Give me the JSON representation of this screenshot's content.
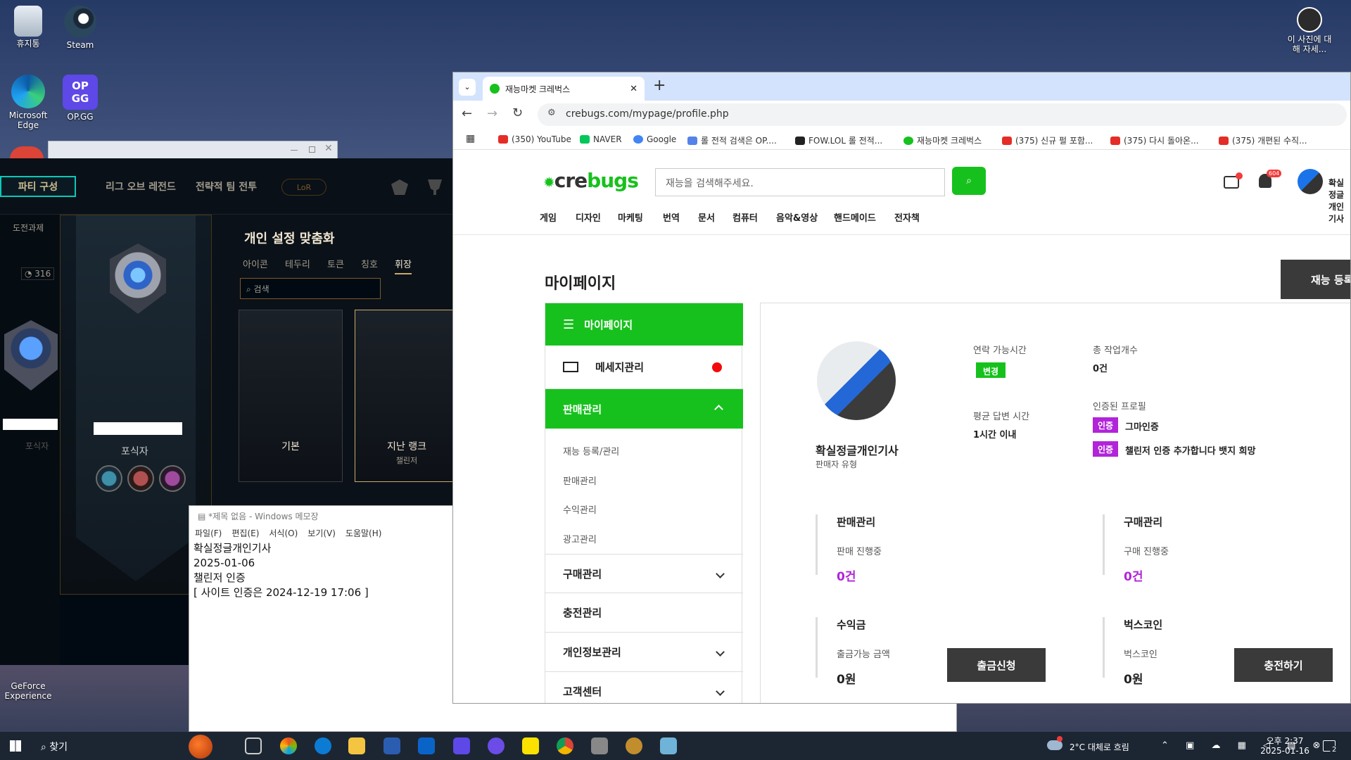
{
  "desktop": {
    "icons": [
      {
        "label": "휴지통"
      },
      {
        "label": "Steam"
      },
      {
        "label": "Microsoft Edge"
      },
      {
        "label": "OP.GG"
      },
      {
        "label": "GeForce Experience"
      }
    ],
    "corner_label": "이 사진에 대해 자세..."
  },
  "lol": {
    "party": "파티 구성",
    "nav": [
      "리그 오브 레전드",
      "전략적 팀 전투"
    ],
    "lor": "LoR",
    "left_label": "도전과제",
    "left_count": "316",
    "left_rank": "포식자",
    "rank_label": "포식자",
    "title": "개인 설정 맞춤화",
    "tabs": [
      "아이콘",
      "테두리",
      "토큰",
      "칭호",
      "휘장"
    ],
    "search_placeholder": "검색",
    "boxes": [
      {
        "title": "기본",
        "sub": ""
      },
      {
        "title": "지난 랭크",
        "sub": "챌린저"
      }
    ]
  },
  "notepad": {
    "title": "*제목 없음 - Windows 메모장",
    "menu": [
      "파일(F)",
      "편집(E)",
      "서식(O)",
      "보기(V)",
      "도움말(H)"
    ],
    "lines": [
      "확실정글개인기사",
      "2025-01-06",
      "챌린저 인증",
      "[ 사이트 인증은 2024-12-19 17:06 ]"
    ]
  },
  "browser": {
    "tab_title": "재능마켓 크레벅스",
    "url": "crebugs.com/mypage/profile.php",
    "bookmarks": [
      {
        "label": "(350) YouTube",
        "color": "#e52d27"
      },
      {
        "label": "NAVER",
        "color": "#03c75a"
      },
      {
        "label": "Google",
        "color": "#4285f4"
      },
      {
        "label": "롤 전적 검색은 OP....",
        "color": "#5383e8"
      },
      {
        "label": "FOW.LOL 롤 전적...",
        "color": "#222222"
      },
      {
        "label": "재능마켓 크레벅스",
        "color": "#17c11d"
      },
      {
        "label": "(375) 신규 펄 포함...",
        "color": "#e52d27"
      },
      {
        "label": "(375) 다시 돌아온...",
        "color": "#e52d27"
      },
      {
        "label": "(375) 개편된 수직...",
        "color": "#e52d27"
      }
    ]
  },
  "site": {
    "logo_pre": "cre",
    "logo_accent": "bugs",
    "search_placeholder": "재능을 검색해주세요.",
    "categories": [
      "게임",
      "디자인",
      "마케팅",
      "번역",
      "문서",
      "컴퓨터",
      "음악&영상",
      "핸드메이드",
      "전자책"
    ],
    "notif_count": "604",
    "username": "확실정글개인기사",
    "page_title": "마이페이지",
    "register_btn": "재능 등록",
    "sidebar": {
      "mypage": "마이페이지",
      "messages": "메세지관리",
      "sales": "판매관리",
      "sales_sub": [
        "재능 등록/관리",
        "판매관리",
        "수익관리",
        "광고관리"
      ],
      "purchase": "구매관리",
      "charge": "충전관리",
      "privacy": "개인정보관리",
      "support": "고객센터"
    },
    "profile": {
      "name": "확실정글개인기사",
      "type": "판매자 유형",
      "contact_label": "연락 가능시간",
      "contact_btn": "변경",
      "avg_label": "평균 답변 시간",
      "avg_value": "1시간 이내",
      "total_label": "총 작업개수",
      "total_value": "0건",
      "cert_label": "인증된 프로필",
      "cert_badge": "인증",
      "certs": [
        "그마인증",
        "챌린저 인증 추가합니다 뱃지 희망"
      ]
    },
    "stats": {
      "sales_title": "판매관리",
      "sales_label": "판매 진행중",
      "sales_value": "0건",
      "buy_title": "구매관리",
      "buy_label": "구매 진행중",
      "buy_value": "0건",
      "earn_title": "수익금",
      "earn_label": "출금가능 금액",
      "earn_value": "0원",
      "earn_btn": "출금신청",
      "coin_title": "벅스코인",
      "coin_label": "벅스코인",
      "coin_value": "0원",
      "coin_btn": "충전하기"
    }
  },
  "taskbar": {
    "search": "찾기",
    "weather": "2°C 대체로 흐림",
    "time": "오후 2:37",
    "date": "2025-01-16",
    "notif": "2"
  }
}
